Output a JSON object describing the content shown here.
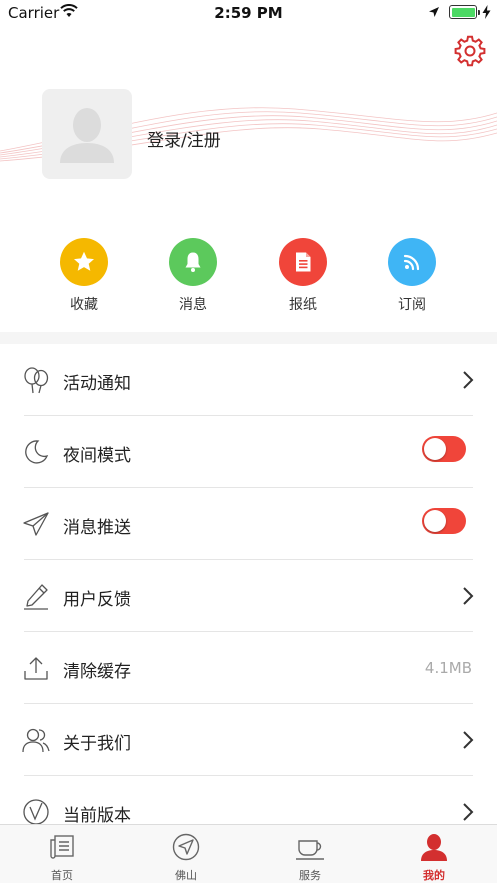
{
  "status_bar": {
    "carrier": "Carrier",
    "time": "2:59 PM"
  },
  "profile": {
    "login_text": "登录/注册"
  },
  "quick_actions": [
    {
      "label": "收藏",
      "icon": "star-icon",
      "color": "#f5b800"
    },
    {
      "label": "消息",
      "icon": "bell-icon",
      "color": "#5cc95c"
    },
    {
      "label": "报纸",
      "icon": "newspaper-icon",
      "color": "#f0453a"
    },
    {
      "label": "订阅",
      "icon": "rss-icon",
      "color": "#3fb5f5"
    }
  ],
  "menu": [
    {
      "label": "活动通知",
      "icon": "balloons-icon",
      "control": "chevron"
    },
    {
      "label": "夜间模式",
      "icon": "moon-icon",
      "control": "toggle",
      "on": true
    },
    {
      "label": "消息推送",
      "icon": "paper-plane-icon",
      "control": "toggle",
      "on": true
    },
    {
      "label": "用户反馈",
      "icon": "pencil-icon",
      "control": "chevron"
    },
    {
      "label": "清除缓存",
      "icon": "upload-icon",
      "control": "value",
      "value": "4.1MB"
    },
    {
      "label": "关于我们",
      "icon": "users-icon",
      "control": "chevron"
    },
    {
      "label": "当前版本",
      "icon": "version-icon",
      "control": "chevron"
    }
  ],
  "tabs": [
    {
      "label": "首页",
      "icon": "news-icon",
      "active": false
    },
    {
      "label": "佛山",
      "icon": "compass-icon",
      "active": false
    },
    {
      "label": "服务",
      "icon": "cup-icon",
      "active": false
    },
    {
      "label": "我的",
      "icon": "person-icon",
      "active": true
    }
  ],
  "colors": {
    "accent": "#d32f2f",
    "toggle_on": "#f0453a",
    "wave": "#f3c4c4"
  }
}
